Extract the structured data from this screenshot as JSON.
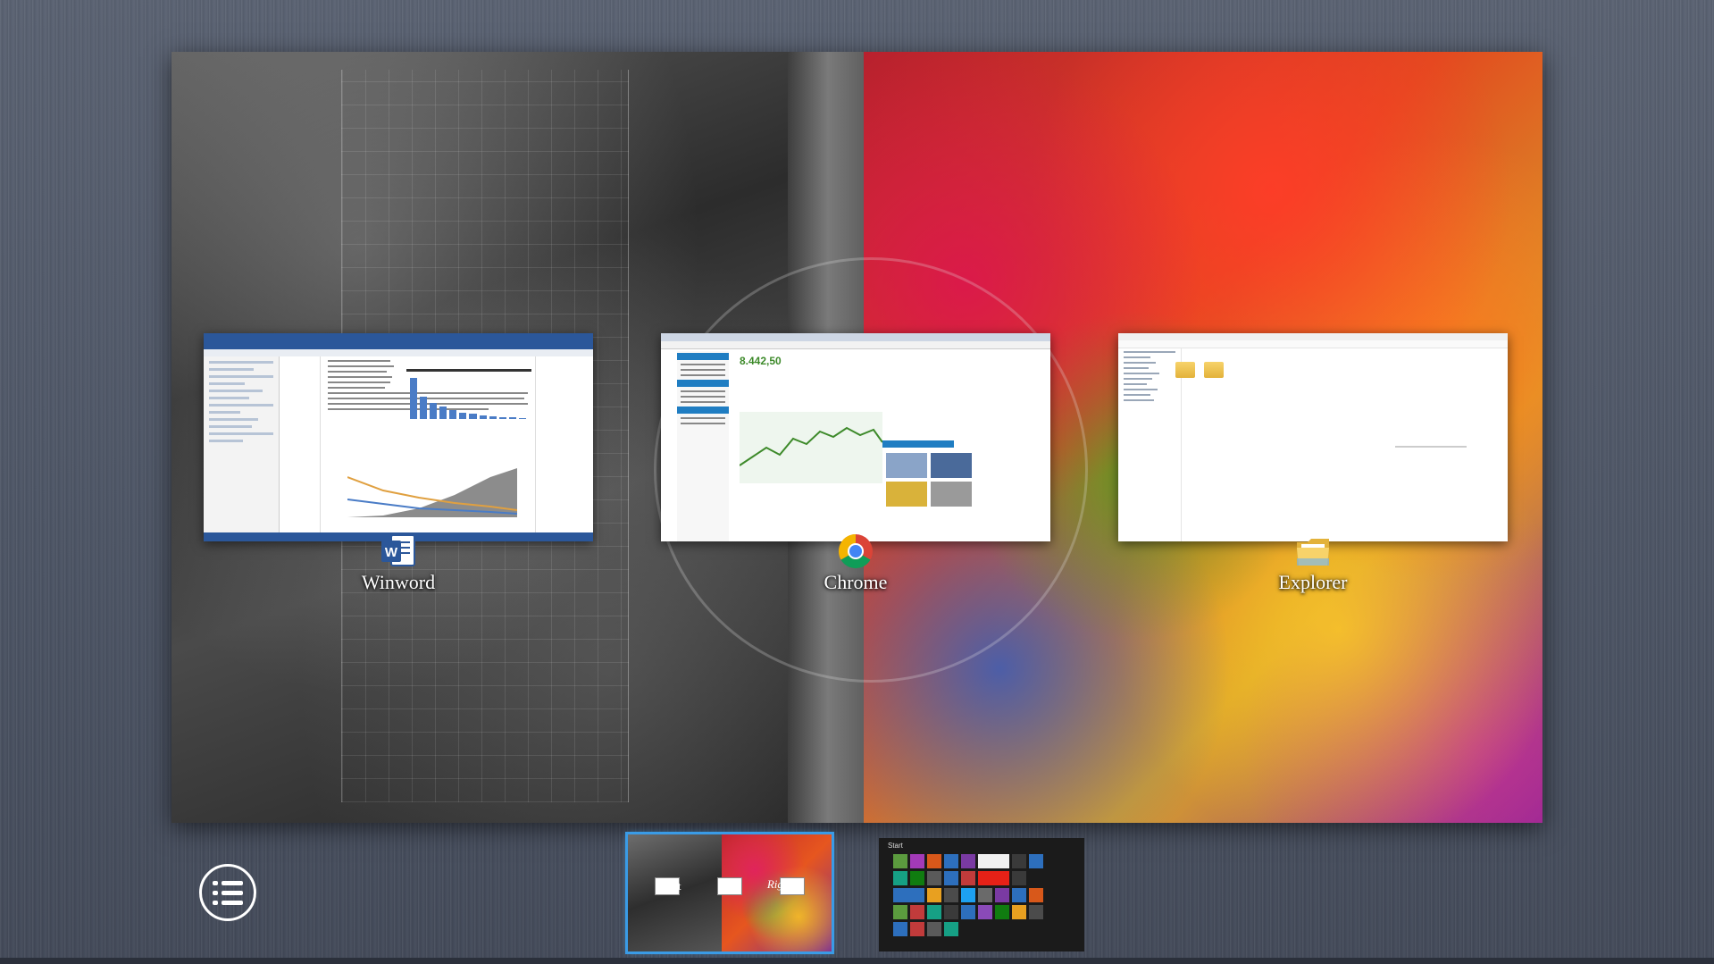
{
  "windows": [
    {
      "name": "Winword",
      "icon": "word-icon"
    },
    {
      "name": "Chrome",
      "icon": "chrome-icon"
    },
    {
      "name": "Explorer",
      "icon": "folder-icon"
    }
  ],
  "chrome_preview": {
    "index_value": "8.442,50"
  },
  "desktop_thumbs": [
    {
      "left_caption": "Left",
      "right_caption": "Right",
      "selected": true
    },
    {
      "start_label": "Start",
      "selected": false
    }
  ],
  "colors": {
    "selection_accent": "#3a9be6",
    "word_blue": "#2b579a",
    "chrome_green": "#3d8a2a"
  }
}
